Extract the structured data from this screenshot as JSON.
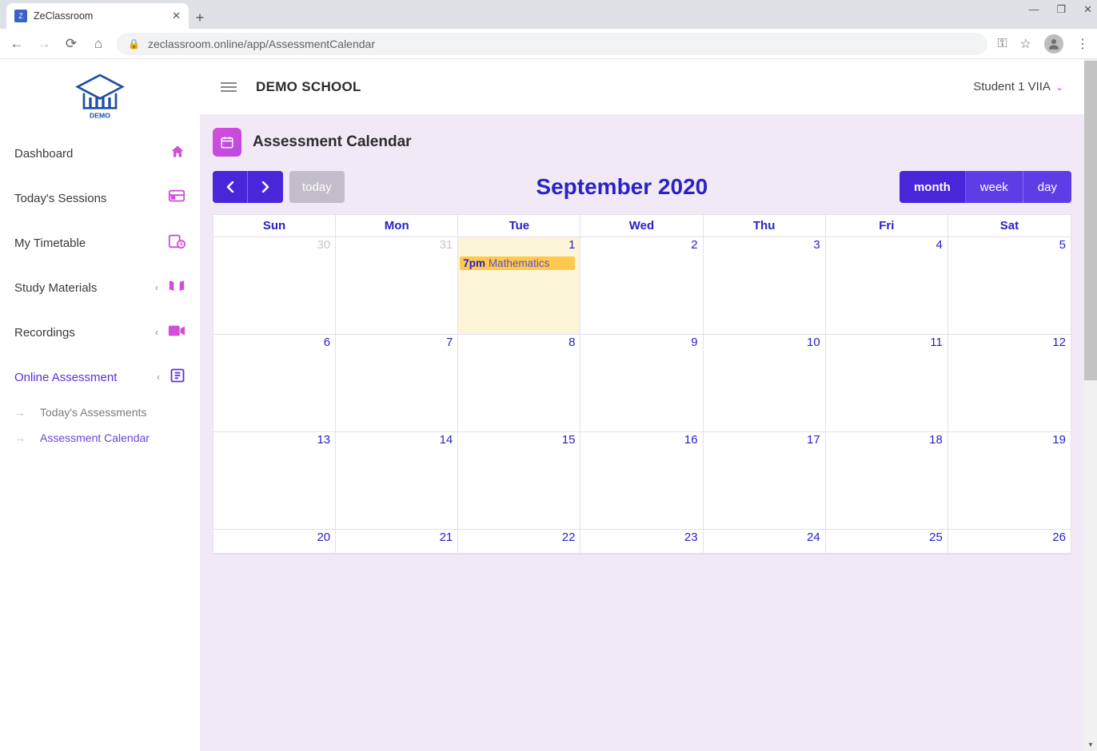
{
  "browser": {
    "tab_title": "ZeClassroom",
    "url": "zeclassroom.online/app/AssessmentCalendar"
  },
  "header": {
    "school": "DEMO SCHOOL",
    "user": "Student 1 VIIA",
    "logo_caption": "DEMO"
  },
  "sidebar": {
    "items": [
      {
        "label": "Dashboard",
        "icon": "home"
      },
      {
        "label": "Today's Sessions",
        "icon": "sessions"
      },
      {
        "label": "My Timetable",
        "icon": "timetable"
      },
      {
        "label": "Study Materials",
        "icon": "book",
        "expandable": true
      },
      {
        "label": "Recordings",
        "icon": "video",
        "expandable": true
      },
      {
        "label": "Online Assessment",
        "icon": "assessment",
        "expandable": true,
        "active": true
      }
    ],
    "sub_items": [
      {
        "label": "Today's Assessments"
      },
      {
        "label": "Assessment Calendar",
        "active": true
      }
    ]
  },
  "page": {
    "title": "Assessment Calendar"
  },
  "calendar": {
    "title": "September 2020",
    "today_label": "today",
    "views": {
      "month": "month",
      "week": "week",
      "day": "day"
    },
    "active_view": "month",
    "day_headers": [
      "Sun",
      "Mon",
      "Tue",
      "Wed",
      "Thu",
      "Fri",
      "Sat"
    ],
    "weeks": [
      [
        {
          "d": "30",
          "other": true
        },
        {
          "d": "31",
          "other": true
        },
        {
          "d": "1",
          "today": true,
          "event": {
            "time": "7pm",
            "title": "Mathematics"
          }
        },
        {
          "d": "2"
        },
        {
          "d": "3"
        },
        {
          "d": "4"
        },
        {
          "d": "5"
        }
      ],
      [
        {
          "d": "6"
        },
        {
          "d": "7"
        },
        {
          "d": "8"
        },
        {
          "d": "9"
        },
        {
          "d": "10"
        },
        {
          "d": "11"
        },
        {
          "d": "12"
        }
      ],
      [
        {
          "d": "13"
        },
        {
          "d": "14"
        },
        {
          "d": "15"
        },
        {
          "d": "16"
        },
        {
          "d": "17"
        },
        {
          "d": "18"
        },
        {
          "d": "19"
        }
      ],
      [
        {
          "d": "20"
        },
        {
          "d": "21"
        },
        {
          "d": "22"
        },
        {
          "d": "23"
        },
        {
          "d": "24"
        },
        {
          "d": "25"
        },
        {
          "d": "26"
        }
      ]
    ]
  }
}
